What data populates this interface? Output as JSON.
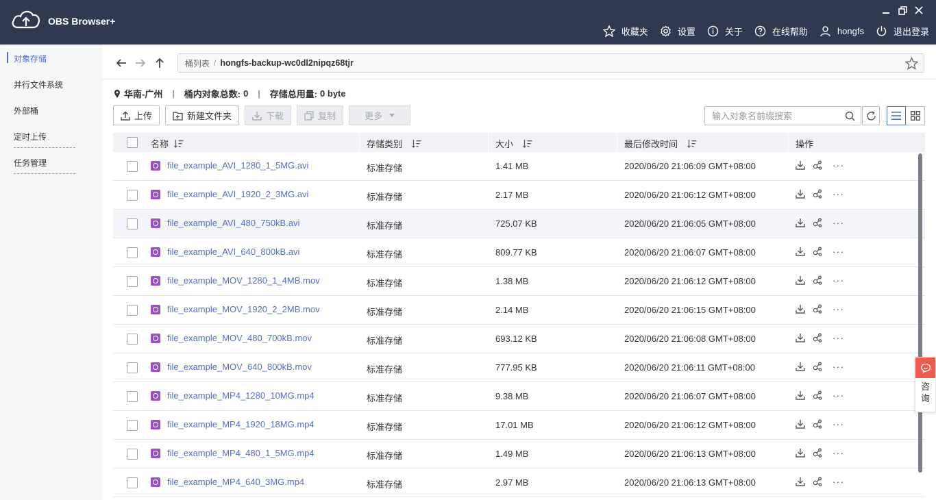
{
  "app": {
    "title": "OBS Browser+"
  },
  "topnav": {
    "favorites": "收藏夹",
    "settings": "设置",
    "about": "关于",
    "help": "在线帮助",
    "user": "hongfs",
    "logout": "退出登录"
  },
  "sidebar": {
    "items": [
      {
        "label": "对象存储"
      },
      {
        "label": "并行文件系统"
      },
      {
        "label": "外部桶"
      },
      {
        "label": "定时上传"
      },
      {
        "label": "任务管理"
      }
    ]
  },
  "path": {
    "root": "桶列表",
    "separator": "/",
    "current": "hongfs-backup-wc0dl2nipqz68tjr"
  },
  "info": {
    "region": "华南-广州",
    "count_label": "桶内对象总数:",
    "count_value": "0",
    "storage_label": "存储总用量:",
    "storage_value": "0 byte"
  },
  "toolbar": {
    "upload": "上传",
    "new_folder": "新建文件夹",
    "download": "下载",
    "copy": "复制",
    "more": "更多"
  },
  "search": {
    "placeholder": "输入对象名前缀搜索"
  },
  "table": {
    "headers": {
      "name": "名称",
      "type": "存储类别",
      "size": "大小",
      "modified": "最后修改时间",
      "actions": "操作"
    },
    "rows": [
      {
        "name": "file_example_AVI_1280_1_5MG.avi",
        "type": "标准存储",
        "size": "1.41 MB",
        "modified": "2020/06/20 21:06:09 GMT+08:00"
      },
      {
        "name": "file_example_AVI_1920_2_3MG.avi",
        "type": "标准存储",
        "size": "2.17 MB",
        "modified": "2020/06/20 21:06:12 GMT+08:00"
      },
      {
        "name": "file_example_AVI_480_750kB.avi",
        "type": "标准存储",
        "size": "725.07 KB",
        "modified": "2020/06/20 21:06:05 GMT+08:00"
      },
      {
        "name": "file_example_AVI_640_800kB.avi",
        "type": "标准存储",
        "size": "809.77 KB",
        "modified": "2020/06/20 21:06:07 GMT+08:00"
      },
      {
        "name": "file_example_MOV_1280_1_4MB.mov",
        "type": "标准存储",
        "size": "1.38 MB",
        "modified": "2020/06/20 21:06:12 GMT+08:00"
      },
      {
        "name": "file_example_MOV_1920_2_2MB.mov",
        "type": "标准存储",
        "size": "2.14 MB",
        "modified": "2020/06/20 21:06:15 GMT+08:00"
      },
      {
        "name": "file_example_MOV_480_700kB.mov",
        "type": "标准存储",
        "size": "693.12 KB",
        "modified": "2020/06/20 21:06:08 GMT+08:00"
      },
      {
        "name": "file_example_MOV_640_800kB.mov",
        "type": "标准存储",
        "size": "777.95 KB",
        "modified": "2020/06/20 21:06:11 GMT+08:00"
      },
      {
        "name": "file_example_MP4_1280_10MG.mp4",
        "type": "标准存储",
        "size": "9.38 MB",
        "modified": "2020/06/20 21:06:07 GMT+08:00"
      },
      {
        "name": "file_example_MP4_1920_18MG.mp4",
        "type": "标准存储",
        "size": "17.01 MB",
        "modified": "2020/06/20 21:06:12 GMT+08:00"
      },
      {
        "name": "file_example_MP4_480_1_5MG.mp4",
        "type": "标准存储",
        "size": "1.49 MB",
        "modified": "2020/06/20 21:06:13 GMT+08:00"
      },
      {
        "name": "file_example_MP4_640_3MG.mp4",
        "type": "标准存储",
        "size": "2.97 MB",
        "modified": "2020/06/20 21:06:13 GMT+08:00"
      }
    ],
    "more_glyph": "···"
  },
  "consult": {
    "label_1": "咨",
    "label_2": "询"
  },
  "colors": {
    "header_bg": "#2f3a50",
    "accent": "#526ecc",
    "file_icon": "#9b4fc0",
    "consult": "#ee5b4f"
  }
}
